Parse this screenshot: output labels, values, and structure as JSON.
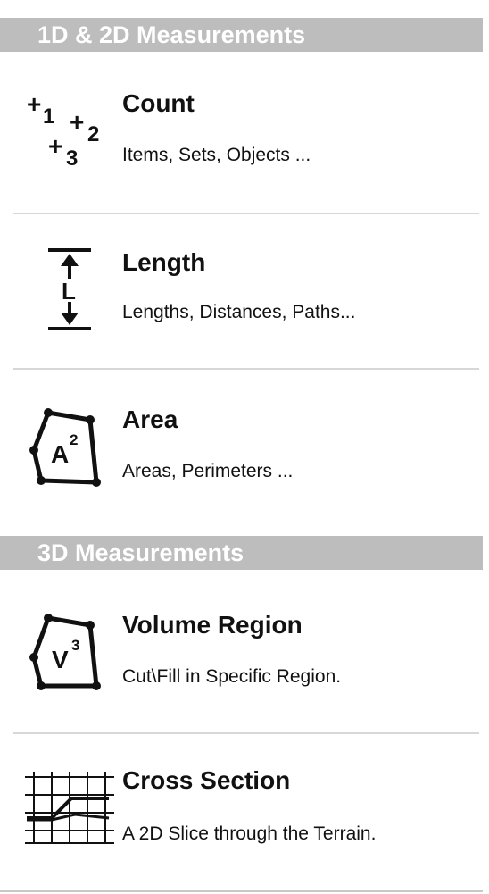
{
  "sections": [
    {
      "title": "1D & 2D Measurements"
    },
    {
      "title": "3D Measurements"
    }
  ],
  "items": [
    {
      "title": "Count",
      "desc": "Items, Sets, Objects ...",
      "icon": "count-icon"
    },
    {
      "title": "Length",
      "desc": "Lengths, Distances, Paths...",
      "icon": "length-icon"
    },
    {
      "title": "Area",
      "desc": "Areas, Perimeters ...",
      "icon": "area-icon"
    },
    {
      "title": "Volume Region",
      "desc": "Cut\\Fill in Specific Region.",
      "icon": "volume-region-icon"
    },
    {
      "title": "Cross Section",
      "desc": "A 2D Slice through the Terrain.",
      "icon": "cross-section-icon"
    }
  ],
  "icon_labels": {
    "count": [
      "+1",
      "+2",
      "+3"
    ],
    "length": "L",
    "area": "A",
    "area_sup": "2",
    "volume": "V",
    "volume_sup": "3"
  },
  "colors": {
    "header_bg": "#bdbdbd",
    "header_text": "#ffffff",
    "divider": "#d7d7d7"
  }
}
